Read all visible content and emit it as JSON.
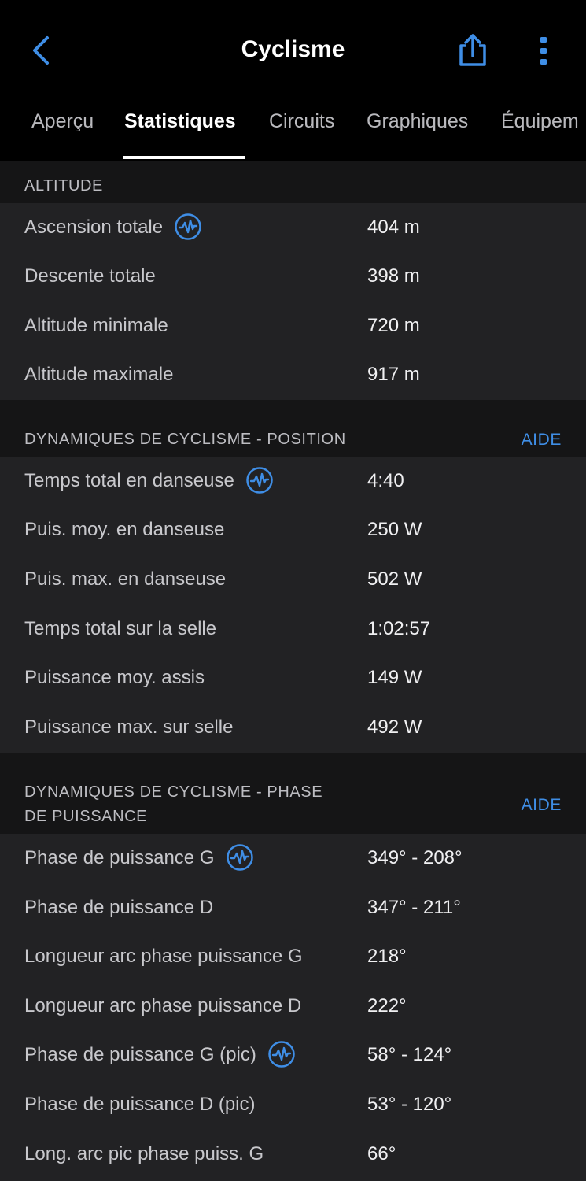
{
  "header": {
    "title": "Cyclisme",
    "back_icon": "chevron-left-icon",
    "share_icon": "share-icon",
    "more_icon": "more-vertical-icon",
    "accent_color": "#3f8ee6"
  },
  "tabs": [
    {
      "label": "Aperçu",
      "active": false
    },
    {
      "label": "Statistiques",
      "active": true
    },
    {
      "label": "Circuits",
      "active": false
    },
    {
      "label": "Graphiques",
      "active": false
    },
    {
      "label": "Équipem",
      "active": false
    }
  ],
  "sections": [
    {
      "title": "ALTITUDE",
      "help": "",
      "rows": [
        {
          "label": "Ascension totale",
          "value": "404 m",
          "chart_icon": true
        },
        {
          "label": "Descente totale",
          "value": "398 m",
          "chart_icon": false
        },
        {
          "label": "Altitude minimale",
          "value": "720 m",
          "chart_icon": false
        },
        {
          "label": "Altitude maximale",
          "value": "917 m",
          "chart_icon": false
        }
      ]
    },
    {
      "title": "DYNAMIQUES DE CYCLISME - POSITION",
      "help": "AIDE",
      "rows": [
        {
          "label": "Temps total en danseuse",
          "value": "4:40",
          "chart_icon": true
        },
        {
          "label": "Puis. moy. en danseuse",
          "value": "250 W",
          "chart_icon": false
        },
        {
          "label": "Puis. max. en danseuse",
          "value": "502 W",
          "chart_icon": false
        },
        {
          "label": "Temps total sur la selle",
          "value": "1:02:57",
          "chart_icon": false
        },
        {
          "label": "Puissance moy. assis",
          "value": "149 W",
          "chart_icon": false
        },
        {
          "label": "Puissance max. sur selle",
          "value": "492 W",
          "chart_icon": false
        }
      ]
    },
    {
      "title_line1": "DYNAMIQUES DE CYCLISME - PHASE",
      "title_line2": "DE PUISSANCE",
      "help": "AIDE",
      "rows": [
        {
          "label": "Phase de puissance G",
          "value": "349° - 208°",
          "chart_icon": true
        },
        {
          "label": "Phase de puissance D",
          "value": "347° - 211°",
          "chart_icon": false
        },
        {
          "label": "Longueur arc phase puissance G",
          "value": "218°",
          "chart_icon": false
        },
        {
          "label": "Longueur arc phase puissance D",
          "value": "222°",
          "chart_icon": false
        },
        {
          "label": "Phase de puissance G (pic)",
          "value": "58° - 124°",
          "chart_icon": true
        },
        {
          "label": "Phase de puissance D (pic)",
          "value": "53° - 120°",
          "chart_icon": false
        },
        {
          "label": "Long. arc pic phase puiss. G",
          "value": "66°",
          "chart_icon": false
        }
      ]
    }
  ]
}
